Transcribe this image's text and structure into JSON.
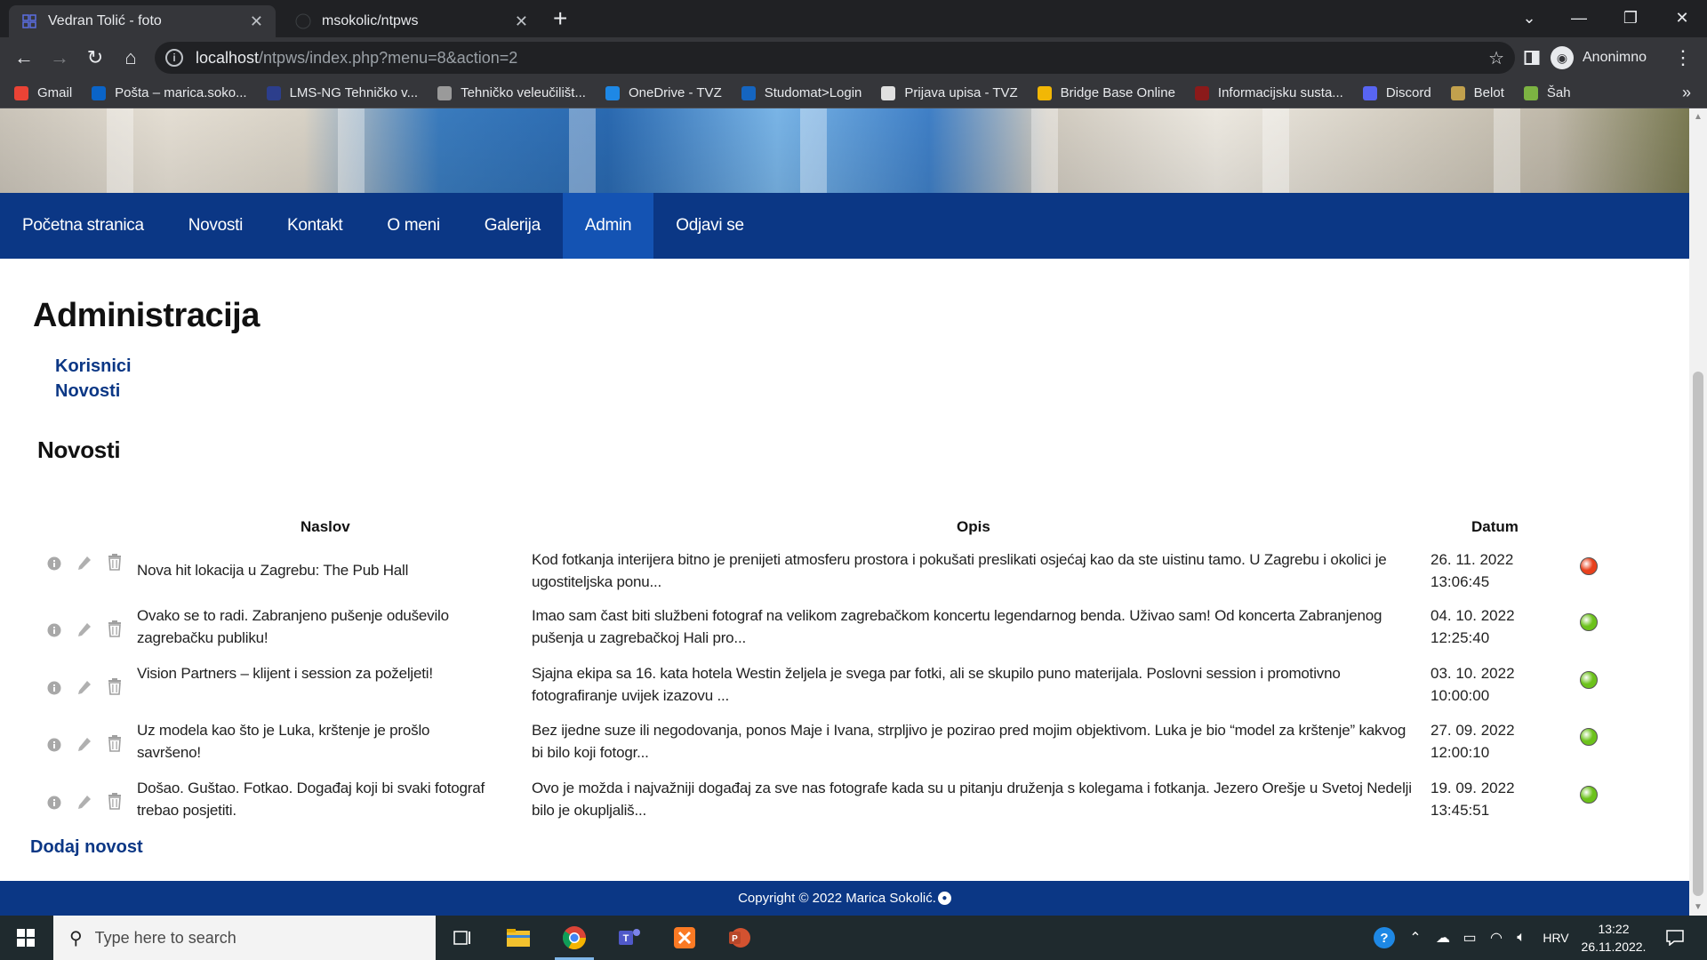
{
  "browser": {
    "tabs": [
      {
        "title": "Vedran Tolić - foto",
        "active": true
      },
      {
        "title": "msokolic/ntpws",
        "active": false
      }
    ],
    "url_host": "localhost",
    "url_path": "/ntpws/index.php?menu=8&action=2",
    "profile_name": "Anonimno",
    "bookmarks": [
      {
        "label": "Gmail",
        "color": "#ea4335"
      },
      {
        "label": "Pošta – marica.soko...",
        "color": "#0a64c8"
      },
      {
        "label": "LMS-NG Tehničko v...",
        "color": "#2c3e8c"
      },
      {
        "label": "Tehničko veleučilišt...",
        "color": "#9a9a9a"
      },
      {
        "label": "OneDrive - TVZ",
        "color": "#1e88e5"
      },
      {
        "label": "Studomat>Login",
        "color": "#1565c0"
      },
      {
        "label": "Prijava upisa - TVZ",
        "color": "#e0e0e0"
      },
      {
        "label": "Bridge Base Online",
        "color": "#f2b705"
      },
      {
        "label": "Informacijsku susta...",
        "color": "#8b1a1a"
      },
      {
        "label": "Discord",
        "color": "#5865f2"
      },
      {
        "label": "Belot",
        "color": "#c2a14d"
      },
      {
        "label": "Šah",
        "color": "#7cb342"
      }
    ],
    "more_label": "»"
  },
  "nav": {
    "items": [
      {
        "label": "Početna stranica",
        "active": false
      },
      {
        "label": "Novosti",
        "active": false
      },
      {
        "label": "Kontakt",
        "active": false
      },
      {
        "label": "O meni",
        "active": false
      },
      {
        "label": "Galerija",
        "active": false
      },
      {
        "label": "Admin",
        "active": true
      },
      {
        "label": "Odjavi se",
        "active": false
      }
    ],
    "color": "#0b3785",
    "active_color": "#1453b3"
  },
  "page": {
    "title": "Administracija",
    "links": [
      "Korisnici",
      "Novosti"
    ],
    "section_title": "Novosti",
    "columns": {
      "naslov": "Naslov",
      "opis": "Opis",
      "datum": "Datum"
    },
    "rows": [
      {
        "title": "Nova hit lokacija u Zagrebu: The Pub Hall",
        "desc": "Kod fotkanja interijera bitno je prenijeti atmosferu prostora i pokušati preslikati osjećaj kao da ste uistinu tamo. U Zagrebu i okolici je ugostiteljska ponu...",
        "date": "26. 11. 2022",
        "time": "13:06:45",
        "status": "red",
        "status_color": "#e8401c"
      },
      {
        "title": "Ovako se to radi. Zabranjeno pušenje oduševilo zagrebačku publiku!",
        "desc": "Imao sam čast biti službeni fotograf na velikom zagrebačkom koncertu legendarnog benda. Uživao sam! Od koncerta Zabranjenog pušenja u zagrebačkoj Hali pro...",
        "date": "04. 10. 2022",
        "time": "12:25:40",
        "status": "green",
        "status_color": "#6cc21b"
      },
      {
        "title": "Vision Partners – klijent i session za poželjeti!",
        "desc": "Sjajna ekipa sa 16. kata hotela Westin željela je svega par fotki, ali se skupilo puno materijala. Poslovni session i promotivno fotografiranje uvijek izazovu ...",
        "date": "03. 10. 2022",
        "time": "10:00:00",
        "status": "green",
        "status_color": "#6cc21b"
      },
      {
        "title": "Uz modela kao što je Luka, krštenje je prošlo savršeno!",
        "desc": "Bez ijedne suze ili negodovanja, ponos Maje i Ivana, strpljivo je pozirao pred mojim objektivom. Luka je bio “model za krštenje” kakvog bi bilo koji fotogr...",
        "date": "27. 09. 2022",
        "time": "12:00:10",
        "status": "green",
        "status_color": "#6cc21b"
      },
      {
        "title": "Došao. Guštao. Fotkao. Događaj koji bi svaki fotograf trebao posjetiti.",
        "desc": "Ovo je možda i najvažniji događaj za sve nas fotografe kada su u pitanju druženja s kolegama i fotkanja. Jezero Orešje u Svetoj Nedelji bilo je okupljališ...",
        "date": "19. 09. 2022",
        "time": "13:45:51",
        "status": "green",
        "status_color": "#6cc21b"
      }
    ],
    "add_link": "Dodaj novost",
    "footer": "Copyright © 2022 Marica Sokolić."
  },
  "taskbar": {
    "search_placeholder": "Type here to search",
    "language": "HRV",
    "time": "13:22",
    "date": "26.11.2022."
  }
}
